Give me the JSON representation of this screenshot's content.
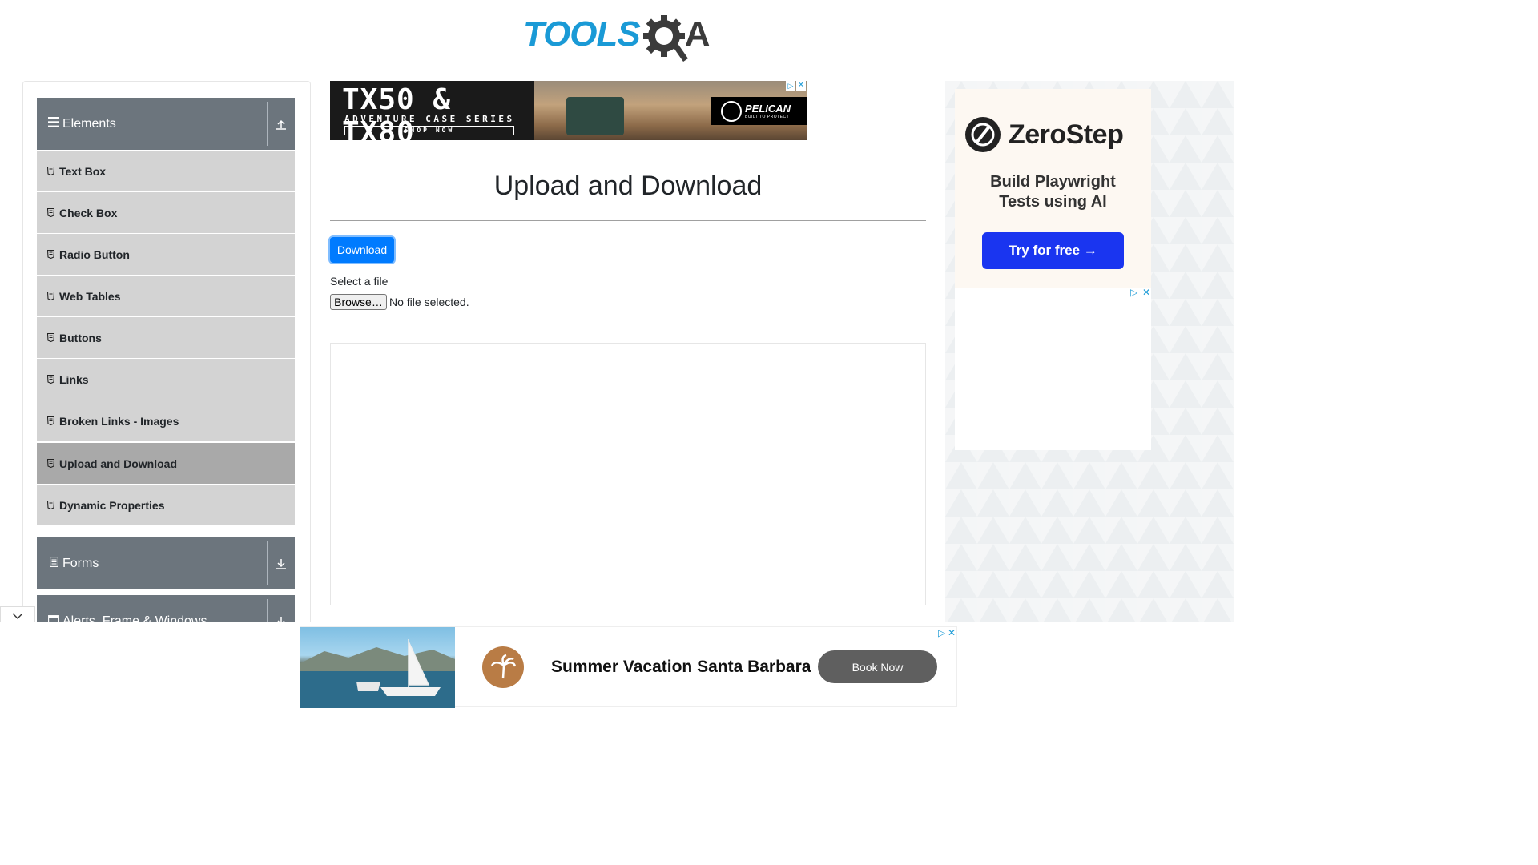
{
  "header": {
    "logo_text_blue": "TOOLS",
    "logo_text_dark": "A",
    "logo_icon": "gear-q-icon"
  },
  "sidebar": {
    "groups": [
      {
        "label": "Elements",
        "icon": "hamburger-icon",
        "toggle_icon": "collapse-up-icon"
      },
      {
        "label": "Forms",
        "icon": "form-icon",
        "toggle_icon": "expand-down-icon"
      },
      {
        "label": "Alerts, Frame & Windows",
        "icon": "window-icon",
        "toggle_icon": "expand-down-icon"
      }
    ],
    "items": [
      {
        "label": "Text Box"
      },
      {
        "label": "Check Box"
      },
      {
        "label": "Radio Button"
      },
      {
        "label": "Web Tables"
      },
      {
        "label": "Buttons"
      },
      {
        "label": "Links"
      },
      {
        "label": "Broken Links - Images"
      },
      {
        "label": "Upload and Download",
        "active": true
      },
      {
        "label": "Dynamic Properties"
      }
    ]
  },
  "top_ad": {
    "headline": "TX50 & TX80",
    "subline": "ADVENTURE CASE SERIES",
    "cta": "SHOP NOW",
    "brand": "PELICAN",
    "brand_tagline": "BUILT TO PROTECT"
  },
  "main": {
    "title": "Upload and Download",
    "download_label": "Download",
    "select_label": "Select a file",
    "browse_label": "Browse…",
    "no_file_text": "No file selected."
  },
  "right_ad": {
    "brand": "ZeroStep",
    "tagline_line1": "Build Playwright",
    "tagline_line2": "Tests using AI",
    "cta": "Try for free →"
  },
  "bottom_ad": {
    "text": "Summer Vacation Santa Barbara",
    "cta": "Book Now"
  },
  "colors": {
    "primary": "#007bff",
    "sidebar_header": "#6c757d",
    "menu_item": "#d3d3d3",
    "menu_active": "#a9a9a9",
    "logo_blue": "#1a9ad6",
    "zerostep_blue": "#1a35f0"
  }
}
